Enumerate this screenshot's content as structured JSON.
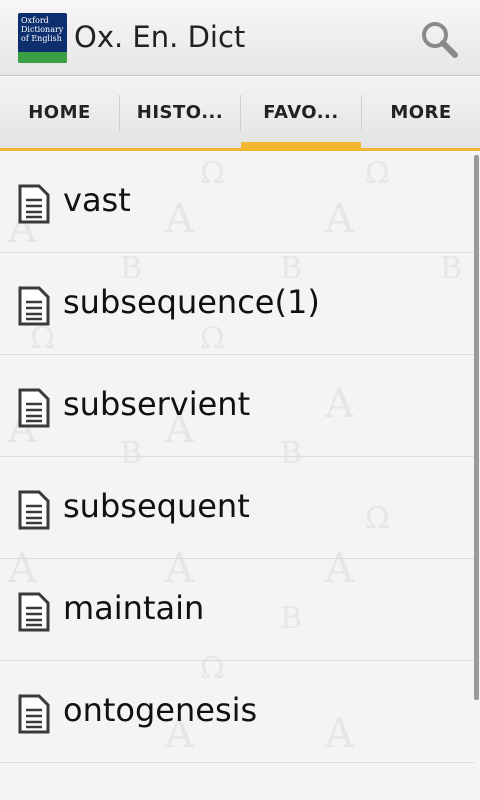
{
  "app": {
    "title": "Ox. En. Dict",
    "logo_text": "Oxford Dictionary of English",
    "logo_icon": "oxford-dictionary-logo",
    "search_icon": "search-icon"
  },
  "tabs": [
    {
      "label": "HOME",
      "selected": false
    },
    {
      "label": "HISTO...",
      "selected": false
    },
    {
      "label": "FAVO...",
      "selected": true
    },
    {
      "label": "MORE",
      "selected": false
    }
  ],
  "favorites": [
    {
      "label": "vast",
      "icon": "document-icon"
    },
    {
      "label": "subsequence(1)",
      "icon": "document-icon"
    },
    {
      "label": "subservient",
      "icon": "document-icon"
    },
    {
      "label": "subsequent",
      "icon": "document-icon"
    },
    {
      "label": "maintain",
      "icon": "document-icon"
    },
    {
      "label": "ontogenesis",
      "icon": "document-icon"
    }
  ],
  "colors": {
    "accent": "#f0b732",
    "logo_blue": "#0d2f6e",
    "logo_green": "#3aa043"
  }
}
